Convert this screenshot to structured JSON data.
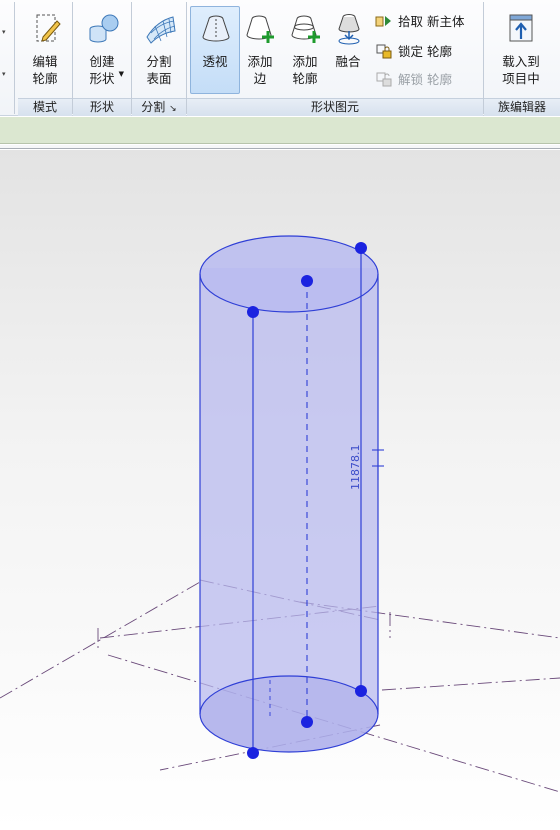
{
  "ribbon": {
    "panels": {
      "mode": {
        "title": "模式",
        "edit_profile": {
          "line1": "编辑",
          "line2": "轮廓",
          "icon": "edit-profile-icon"
        }
      },
      "shape": {
        "title": "形状",
        "create_form": {
          "line1": "创建",
          "line2": "形状",
          "icon": "create-form-icon"
        }
      },
      "divide": {
        "title": "分割",
        "divide_surface": {
          "line1": "分割",
          "line2": "表面",
          "icon": "divide-surface-icon"
        }
      },
      "form_element": {
        "title": "形状图元",
        "xray": {
          "line1": "透视",
          "icon": "xray-icon",
          "active": true
        },
        "add_edge": {
          "line1": "添加",
          "line2": "边",
          "icon": "add-edge-icon"
        },
        "add_profile": {
          "line1": "添加",
          "line2": "轮廓",
          "icon": "add-profile-icon"
        },
        "dissolve": {
          "line1": "融合",
          "icon": "dissolve-icon"
        },
        "pick_new_host": {
          "label": "拾取 新主体",
          "icon": "pick-host-icon"
        },
        "lock_profile": {
          "label": "锁定 轮廓",
          "icon": "lock-icon"
        },
        "unlock_profile": {
          "label": "解锁 轮廓",
          "icon": "unlock-icon",
          "enabled": false
        }
      },
      "family_editor": {
        "title": "族编辑器",
        "load_into_project": {
          "line1": "载入到",
          "line2": "项目中",
          "icon": "load-into-project-icon"
        }
      }
    }
  },
  "viewport": {
    "dimension_label": "11878.1",
    "selection_color": "#2f3fd6",
    "cylinder_fill": "#b7b9ee"
  }
}
